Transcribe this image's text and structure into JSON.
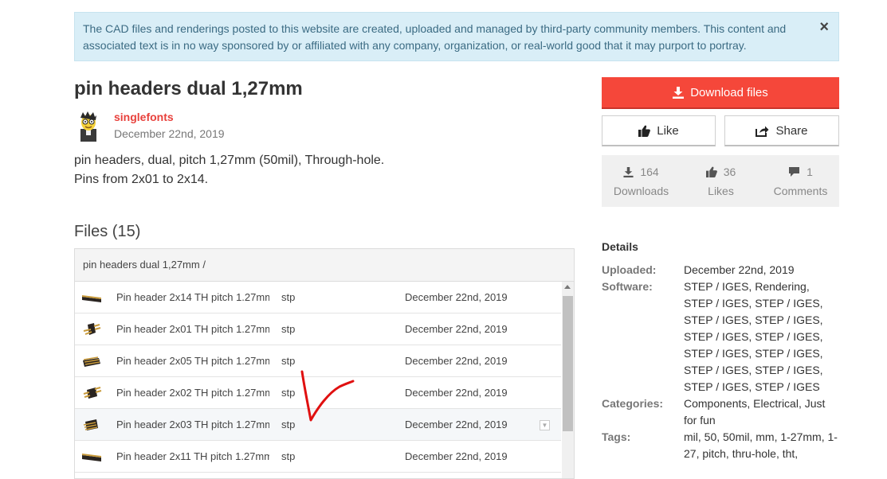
{
  "banner": {
    "text": "The CAD files and renderings posted to this website are created, uploaded and managed by third-party community members. This content and associated text is in no way sponsored by or affiliated with any company, organization, or real-world good that it may purport to portray.",
    "close": "×"
  },
  "model": {
    "title": "pin headers dual 1,27mm",
    "author": "singlefonts",
    "date": "December 22nd, 2019",
    "description": [
      "pin headers, dual, pitch 1,27mm (50mil), Through-hole.",
      "Pins from 2x01 to 2x14."
    ]
  },
  "files": {
    "heading": "Files (15)",
    "path": "pin headers dual 1,27mm /",
    "rows": [
      {
        "name": "Pin header 2x14 TH pitch 1.27mm...",
        "type": "stp",
        "date": "December 22nd, 2019"
      },
      {
        "name": "Pin header 2x01 TH pitch 1.27mm...",
        "type": "stp",
        "date": "December 22nd, 2019"
      },
      {
        "name": "Pin header 2x05 TH pitch 1.27mm...",
        "type": "stp",
        "date": "December 22nd, 2019"
      },
      {
        "name": "Pin header 2x02 TH pitch 1.27mm...",
        "type": "stp",
        "date": "December 22nd, 2019"
      },
      {
        "name": "Pin header 2x03 TH pitch 1.27mm...",
        "type": "stp",
        "date": "December 22nd, 2019"
      },
      {
        "name": "Pin header 2x11 TH pitch 1.27mm...",
        "type": "stp",
        "date": "December 22nd, 2019"
      }
    ]
  },
  "actions": {
    "download": "Download files",
    "like": "Like",
    "share": "Share"
  },
  "stats": {
    "downloads": {
      "value": "164",
      "label": "Downloads"
    },
    "likes": {
      "value": "36",
      "label": "Likes"
    },
    "comments": {
      "value": "1",
      "label": "Comments"
    }
  },
  "details": {
    "heading": "Details",
    "uploaded_label": "Uploaded:",
    "uploaded": "December 22nd, 2019",
    "software_label": "Software:",
    "software": "STEP / IGES, Rendering, STEP / IGES, STEP / IGES, STEP / IGES, STEP / IGES, STEP / IGES, STEP / IGES, STEP / IGES, STEP / IGES, STEP / IGES, STEP / IGES, STEP / IGES, STEP / IGES",
    "categories_label": "Categories:",
    "categories": "Components, Electrical, Just for fun",
    "tags_label": "Tags:",
    "tags": "mil, 50, 50mil, mm, 1-27mm, 1-27, pitch, thru-hole, tht,"
  },
  "colors": {
    "accent": "#f5473a",
    "banner_bg": "#d9eef7",
    "author": "#e8413c",
    "annotation": "#e01010"
  },
  "icons": [
    "close-icon",
    "download-icon",
    "thumbs-up-icon",
    "share-icon",
    "comment-icon",
    "chevron-down-icon",
    "pin-header-thumbnail"
  ]
}
